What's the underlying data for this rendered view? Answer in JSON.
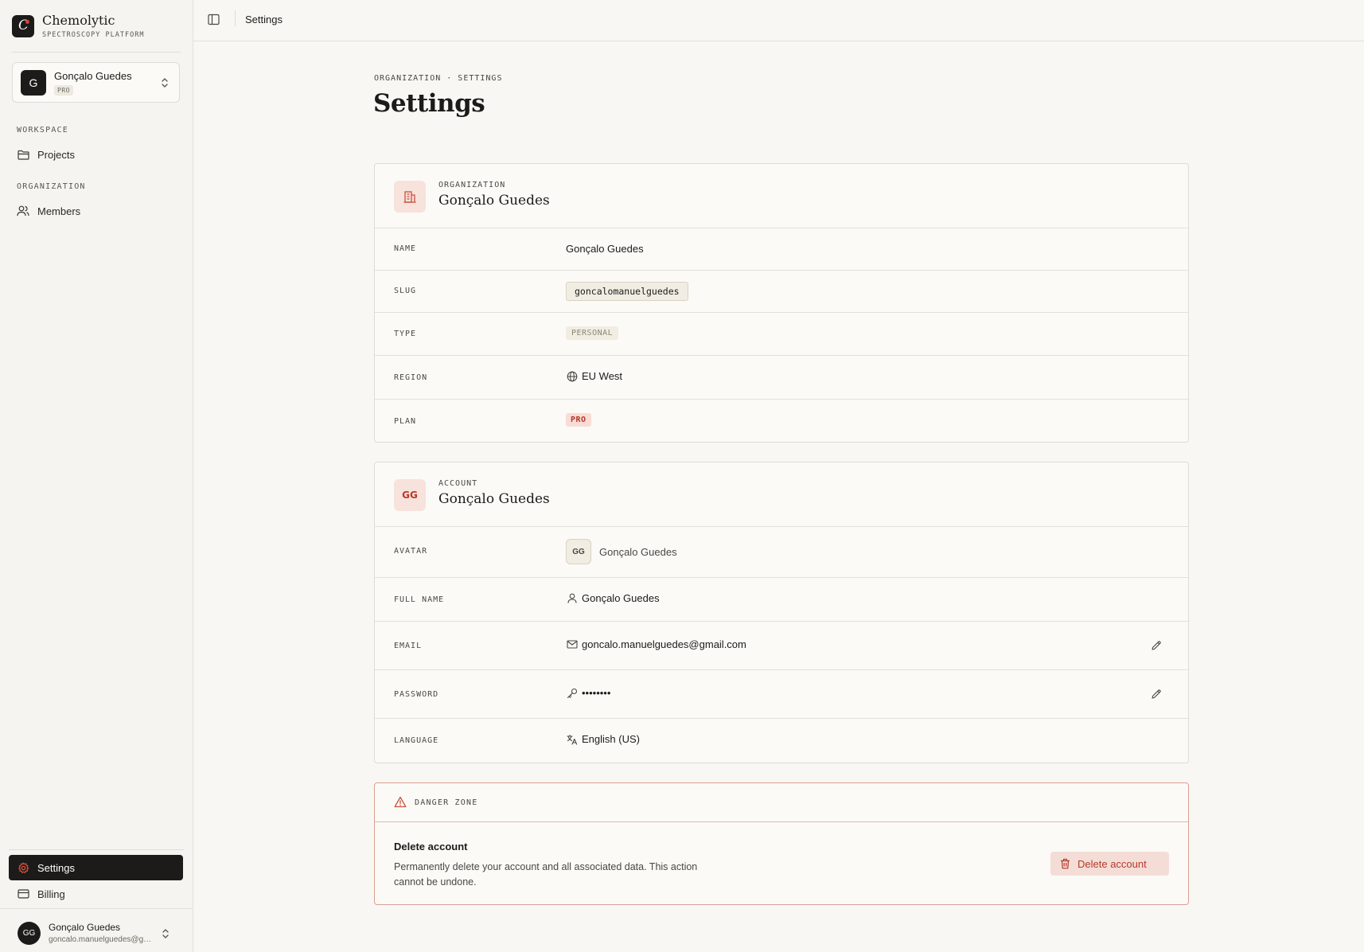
{
  "app": {
    "name": "Chemolytic",
    "tagline": "SPECTROSCOPY PLATFORM",
    "accent": "#d0432f"
  },
  "org_switcher": {
    "initial": "G",
    "name": "Gonçalo Guedes",
    "badge": "PRO"
  },
  "sidebar": {
    "workspace_label": "WORKSPACE",
    "organization_label": "ORGANIZATION",
    "items": [
      {
        "label": "Projects",
        "icon": "folder-icon"
      },
      {
        "label": "Members",
        "icon": "users-icon"
      }
    ],
    "bottom_items": [
      {
        "label": "Settings",
        "icon": "gear-icon",
        "active": true
      },
      {
        "label": "Billing",
        "icon": "credit-card-icon",
        "active": false
      }
    ]
  },
  "user": {
    "initials": "GG",
    "name": "Gonçalo Guedes",
    "email": "goncalo.manuelguedes@gmail.com"
  },
  "topbar": {
    "title": "Settings"
  },
  "page": {
    "breadcrumb": "ORGANIZATION · SETTINGS",
    "title": "Settings"
  },
  "org_card": {
    "kicker": "ORGANIZATION",
    "title": "Gonçalo Guedes",
    "rows": {
      "name": {
        "label": "NAME",
        "value": "Gonçalo Guedes"
      },
      "slug": {
        "label": "SLUG",
        "value": "goncalomanuelguedes"
      },
      "type": {
        "label": "TYPE",
        "value": "PERSONAL"
      },
      "region": {
        "label": "REGION",
        "value": "EU West"
      },
      "plan": {
        "label": "PLAN",
        "value": "PRO"
      }
    }
  },
  "account_card": {
    "kicker": "ACCOUNT",
    "title": "Gonçalo Guedes",
    "initials": "GG",
    "rows": {
      "avatar": {
        "label": "AVATAR",
        "initials": "GG",
        "value": "Gonçalo Guedes"
      },
      "full_name": {
        "label": "FULL NAME",
        "value": "Gonçalo Guedes"
      },
      "email": {
        "label": "EMAIL",
        "value": "goncalo.manuelguedes@gmail.com"
      },
      "password": {
        "label": "PASSWORD",
        "value": "••••••••"
      },
      "language": {
        "label": "LANGUAGE",
        "value": "English (US)"
      }
    }
  },
  "danger_zone": {
    "title": "DANGER ZONE",
    "item_title": "Delete account",
    "item_desc": "Permanently delete your account and all associated data. This action cannot be undone.",
    "button": "Delete account"
  }
}
